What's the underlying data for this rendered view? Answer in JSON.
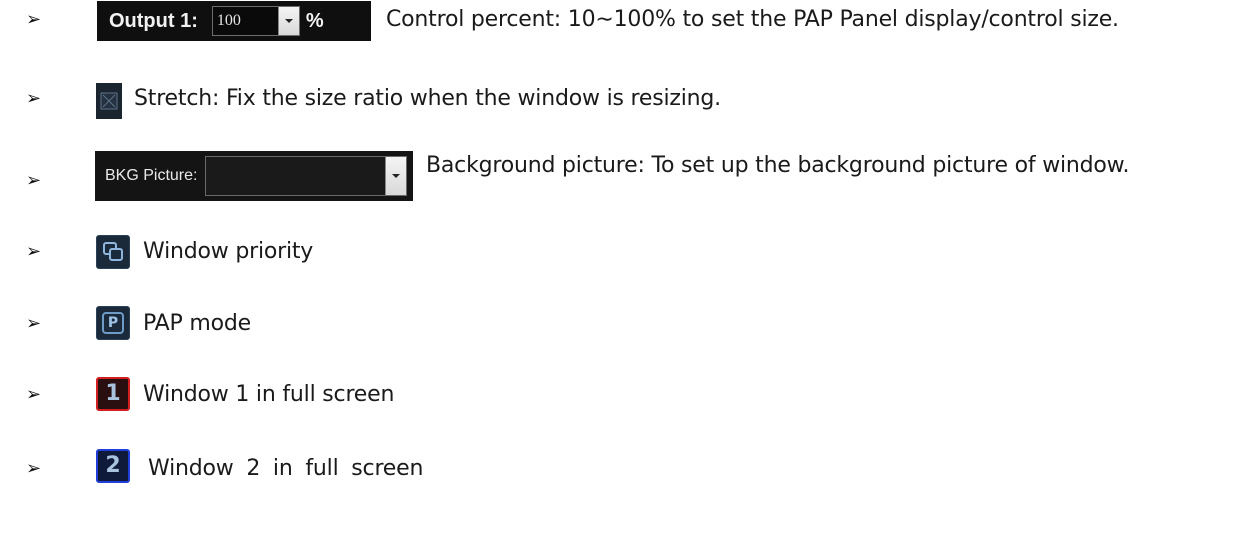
{
  "bullet_glyph": "➢",
  "rows": [
    {
      "control_label": "Output 1:",
      "control_value": "100",
      "control_suffix": "%",
      "description": "Control percent: 10∼100% to set the PAP Panel display/control size."
    },
    {
      "icon": "stretch-icon",
      "description": "Stretch: Fix the size ratio when the window is resizing."
    },
    {
      "control_label": "BKG Picture:",
      "control_value": "",
      "description": "Background picture: To set up the background picture of window."
    },
    {
      "icon": "window-priority-icon",
      "description": "Window priority"
    },
    {
      "icon": "pap-mode-icon",
      "icon_text": "P",
      "description": "PAP mode"
    },
    {
      "icon": "window-1-fullscreen-icon",
      "icon_text": "1",
      "icon_border_color": "#d21f1f",
      "description": "Window 1 in full screen"
    },
    {
      "icon": "window-2-fullscreen-icon",
      "icon_text": "2",
      "icon_border_color": "#1f3fd8",
      "description": "Window 2 in full screen"
    }
  ]
}
